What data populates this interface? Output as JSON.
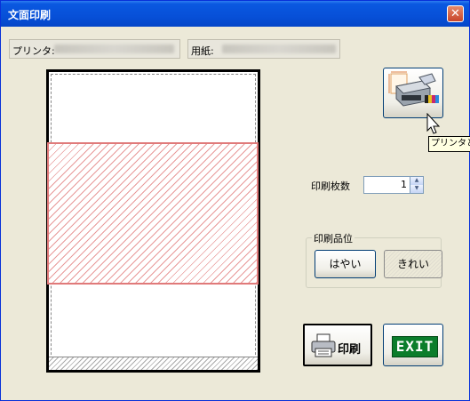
{
  "window": {
    "title": "文面印刷",
    "close_glyph": "✕"
  },
  "info": {
    "printer_label": "プリンタ:",
    "paper_label": "用紙:"
  },
  "printer_button": {
    "icon": "printer-setup-icon"
  },
  "tooltip": {
    "text": "プリンタと用"
  },
  "copies": {
    "label": "印刷枚数",
    "value": "1"
  },
  "quality": {
    "group_label": "印刷品位",
    "options": [
      "はやい",
      "きれい"
    ],
    "selected": "きれい"
  },
  "actions": {
    "print_label": "印刷",
    "exit_label": "EXIT"
  },
  "colors": {
    "title_bar": "#0750d8",
    "print_area_border": "#e07a7a",
    "exit_sign": "#0b7d2b"
  }
}
